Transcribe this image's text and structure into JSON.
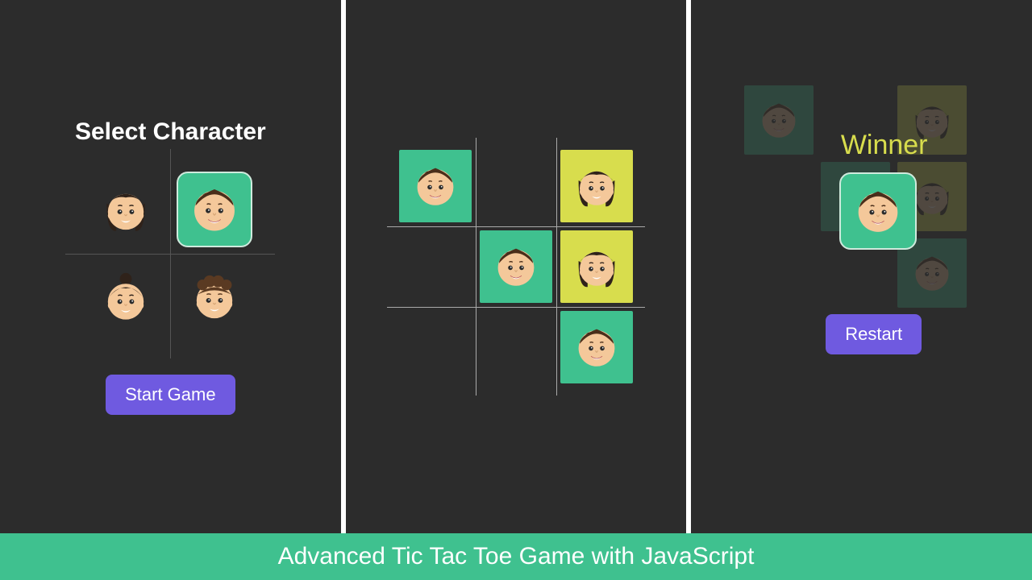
{
  "colors": {
    "bg": "#2c2c2c",
    "accent_green": "#3fc18f",
    "accent_yellow": "#d8dd4d",
    "button_purple": "#6f5ae0",
    "divider_white": "#ffffff"
  },
  "banner": {
    "text": "Advanced Tic Tac Toe Game with JavaScript"
  },
  "panel_select": {
    "title": "Select Character",
    "characters": [
      {
        "id": "woman-bob-hair",
        "selected": false
      },
      {
        "id": "man-short-hair",
        "selected": true
      },
      {
        "id": "woman-bun-hair",
        "selected": false
      },
      {
        "id": "man-curly-hair",
        "selected": false
      }
    ],
    "start_button_label": "Start Game"
  },
  "panel_board": {
    "cells": [
      {
        "pos": 0,
        "player": "p1",
        "avatar": "man-short-hair"
      },
      {
        "pos": 1,
        "player": null
      },
      {
        "pos": 2,
        "player": "p2",
        "avatar": "woman-bob-hair"
      },
      {
        "pos": 3,
        "player": null
      },
      {
        "pos": 4,
        "player": "p1",
        "avatar": "man-short-hair"
      },
      {
        "pos": 5,
        "player": "p2",
        "avatar": "woman-bob-hair"
      },
      {
        "pos": 6,
        "player": null
      },
      {
        "pos": 7,
        "player": null
      },
      {
        "pos": 8,
        "player": "p1",
        "avatar": "man-short-hair"
      }
    ]
  },
  "panel_winner": {
    "label": "Winner",
    "winning_avatar": "man-short-hair",
    "restart_button_label": "Restart",
    "faded_cells": [
      {
        "pos": 0,
        "player": "p1",
        "avatar": "man-short-hair"
      },
      {
        "pos": 2,
        "player": "p2",
        "avatar": "woman-bob-hair"
      },
      {
        "pos": 4,
        "player": "p1",
        "avatar": "man-short-hair"
      },
      {
        "pos": 5,
        "player": "p2",
        "avatar": "woman-bob-hair"
      },
      {
        "pos": 8,
        "player": "p1",
        "avatar": "man-short-hair"
      }
    ]
  }
}
